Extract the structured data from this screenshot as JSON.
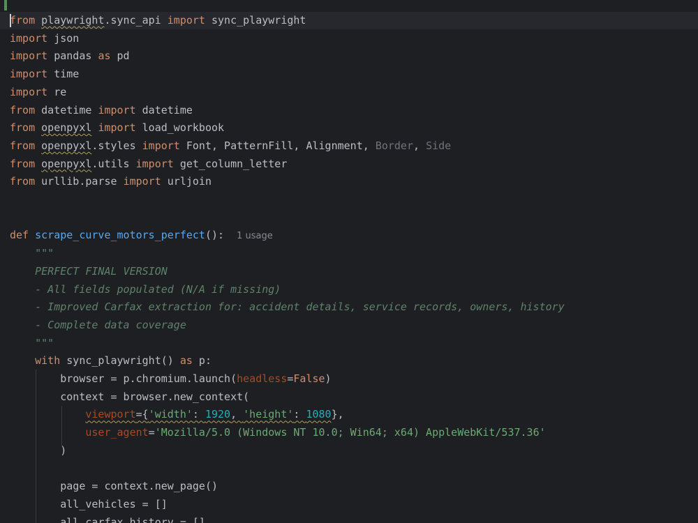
{
  "editor": {
    "lines": [
      {
        "tokens": [
          {
            "t": "from",
            "c": "kw"
          },
          {
            "t": " "
          },
          {
            "t": "playwright",
            "c": "wavy"
          },
          {
            "t": ".sync_api "
          },
          {
            "t": "import",
            "c": "kw"
          },
          {
            "t": " sync_playwright"
          }
        ]
      },
      {
        "tokens": [
          {
            "t": "import",
            "c": "kw"
          },
          {
            "t": " json"
          }
        ]
      },
      {
        "tokens": [
          {
            "t": "import",
            "c": "kw"
          },
          {
            "t": " pandas "
          },
          {
            "t": "as",
            "c": "kw"
          },
          {
            "t": " pd"
          }
        ]
      },
      {
        "tokens": [
          {
            "t": "import",
            "c": "kw"
          },
          {
            "t": " time"
          }
        ]
      },
      {
        "tokens": [
          {
            "t": "import",
            "c": "kw"
          },
          {
            "t": " re"
          }
        ]
      },
      {
        "tokens": [
          {
            "t": "from",
            "c": "kw"
          },
          {
            "t": " datetime "
          },
          {
            "t": "import",
            "c": "kw"
          },
          {
            "t": " datetime"
          }
        ]
      },
      {
        "tokens": [
          {
            "t": "from",
            "c": "kw"
          },
          {
            "t": " "
          },
          {
            "t": "openpyxl",
            "c": "wavy"
          },
          {
            "t": " "
          },
          {
            "t": "import",
            "c": "kw"
          },
          {
            "t": " load_workbook"
          }
        ]
      },
      {
        "tokens": [
          {
            "t": "from",
            "c": "kw"
          },
          {
            "t": " "
          },
          {
            "t": "openpyxl",
            "c": "wavy"
          },
          {
            "t": ".styles "
          },
          {
            "t": "import",
            "c": "kw"
          },
          {
            "t": " Font, PatternFill, Alignment, "
          },
          {
            "t": "Border",
            "c": "grey"
          },
          {
            "t": ", "
          },
          {
            "t": "Side",
            "c": "grey"
          }
        ]
      },
      {
        "tokens": [
          {
            "t": "from",
            "c": "kw"
          },
          {
            "t": " "
          },
          {
            "t": "openpyxl",
            "c": "wavy"
          },
          {
            "t": ".utils "
          },
          {
            "t": "import",
            "c": "kw"
          },
          {
            "t": " get_column_letter"
          }
        ]
      },
      {
        "tokens": [
          {
            "t": "from",
            "c": "kw"
          },
          {
            "t": " urllib.parse "
          },
          {
            "t": "import",
            "c": "kw"
          },
          {
            "t": " urljoin"
          }
        ]
      },
      {
        "tokens": []
      },
      {
        "tokens": []
      },
      {
        "tokens": [
          {
            "t": "def",
            "c": "kw"
          },
          {
            "t": " "
          },
          {
            "t": "scrape_curve_motors_perfect",
            "c": "fn"
          },
          {
            "t": "():  "
          },
          {
            "t": "1 usage",
            "c": "hint"
          }
        ]
      },
      {
        "tokens": [
          {
            "t": "    "
          },
          {
            "t": "\"\"\"",
            "c": "doc"
          }
        ]
      },
      {
        "tokens": [
          {
            "t": "    "
          },
          {
            "t": "PERFECT FINAL VERSION",
            "c": "doc"
          }
        ]
      },
      {
        "tokens": [
          {
            "t": "    "
          },
          {
            "t": "- All fields populated (N/A if missing)",
            "c": "doc"
          }
        ]
      },
      {
        "tokens": [
          {
            "t": "    "
          },
          {
            "t": "- Improved Carfax extraction for: accident details, service records, owners, history",
            "c": "doc"
          }
        ]
      },
      {
        "tokens": [
          {
            "t": "    "
          },
          {
            "t": "- Complete data coverage",
            "c": "doc"
          }
        ]
      },
      {
        "tokens": [
          {
            "t": "    "
          },
          {
            "t": "\"\"\"",
            "c": "doc"
          }
        ]
      },
      {
        "tokens": [
          {
            "t": "    "
          },
          {
            "t": "with",
            "c": "kw"
          },
          {
            "t": " sync_playwright() "
          },
          {
            "t": "as",
            "c": "kw"
          },
          {
            "t": " p:"
          }
        ]
      },
      {
        "tokens": [
          {
            "t": "        browser = p.chromium.launch("
          },
          {
            "t": "headless",
            "c": "named"
          },
          {
            "t": "="
          },
          {
            "t": "False",
            "c": "kw"
          },
          {
            "t": ")"
          }
        ]
      },
      {
        "tokens": [
          {
            "t": "        context = browser.new_context("
          }
        ]
      },
      {
        "tokens": [
          {
            "t": "            "
          },
          {
            "t": "viewport",
            "c": "named wavy"
          },
          {
            "t": "={",
            "c": "wavy"
          },
          {
            "t": "'width'",
            "c": "str wavy"
          },
          {
            "t": ": ",
            "c": "wavy"
          },
          {
            "t": "1920",
            "c": "num wavy"
          },
          {
            "t": ", ",
            "c": "wavy"
          },
          {
            "t": "'height'",
            "c": "str wavy"
          },
          {
            "t": ": ",
            "c": "wavy"
          },
          {
            "t": "1080",
            "c": "num wavy"
          },
          {
            "t": "},"
          }
        ]
      },
      {
        "tokens": [
          {
            "t": "            "
          },
          {
            "t": "user_agent",
            "c": "named"
          },
          {
            "t": "="
          },
          {
            "t": "'Mozilla/5.0 (Windows NT 10.0; Win64; x64) AppleWebKit/537.36'",
            "c": "str"
          }
        ]
      },
      {
        "tokens": [
          {
            "t": "        )"
          }
        ]
      },
      {
        "tokens": []
      },
      {
        "tokens": [
          {
            "t": "        page = context.new_page()"
          }
        ]
      },
      {
        "tokens": [
          {
            "t": "        all_vehicles = []"
          }
        ]
      },
      {
        "tokens": [
          {
            "t": "        all_carfax_history = []"
          }
        ]
      }
    ]
  }
}
